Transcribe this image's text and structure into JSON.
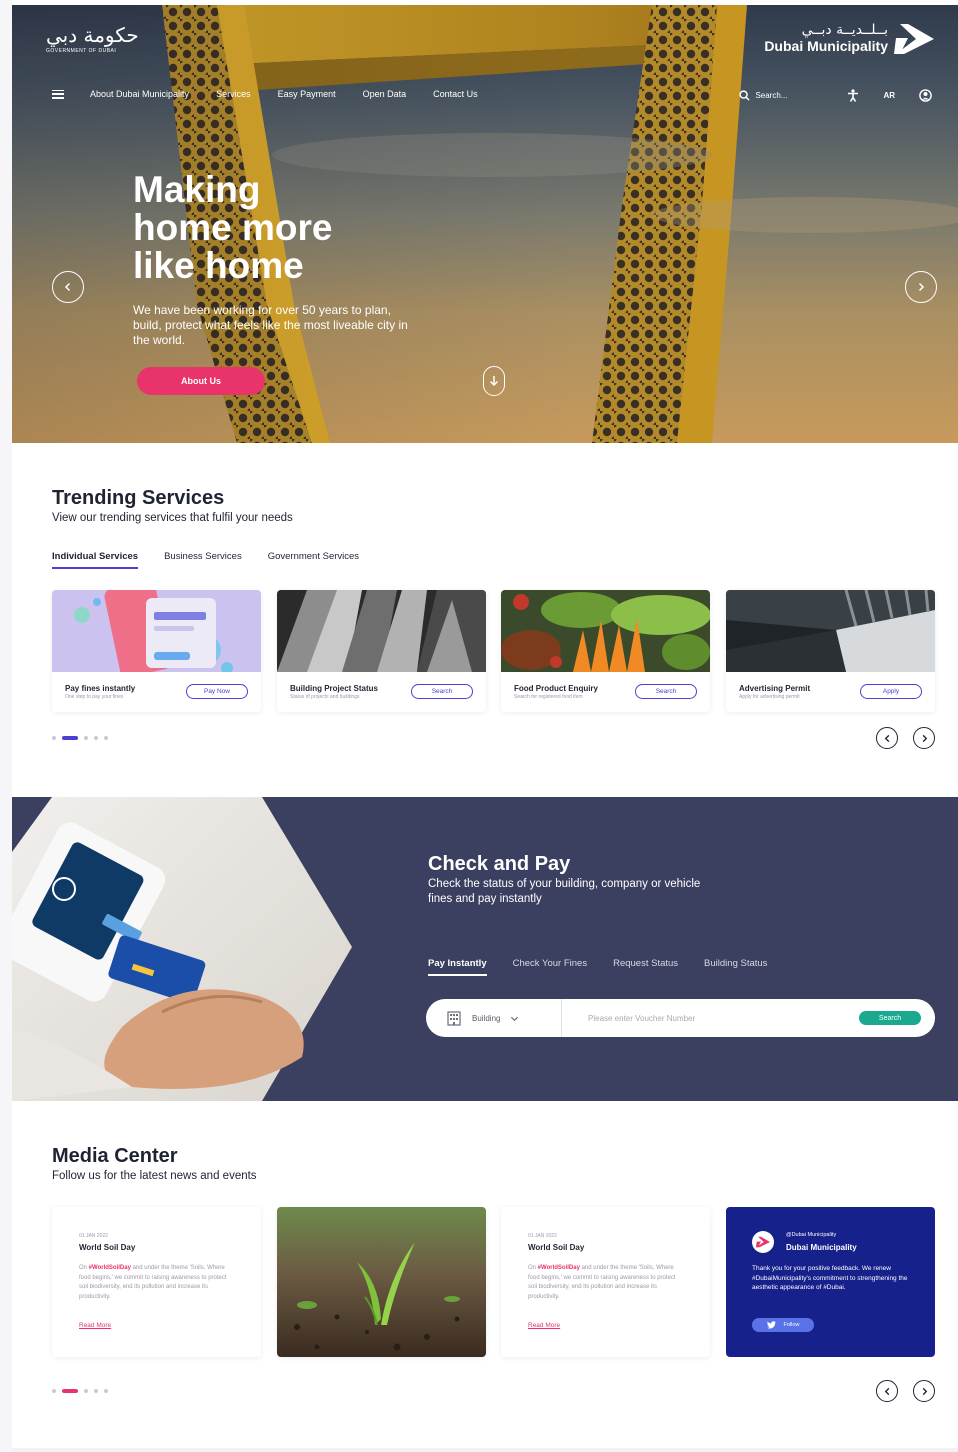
{
  "header": {
    "gov_logo_arabic": "حكومة دبي",
    "gov_logo_sub": "GOVERNMENT OF DUBAI",
    "dm_logo_arabic": "بــلــديــة دبــي",
    "dm_logo_name": "Dubai Municipality",
    "nav": [
      "About Dubai Municipality",
      "Services",
      "Easy Payment",
      "Open Data",
      "Contact Us"
    ],
    "search_placeholder": "Search...",
    "lang": "AR"
  },
  "hero": {
    "title_lines": [
      "Making",
      "home more",
      "like home"
    ],
    "description": "We have been working for over 50 years to plan, build, protect what feels like the most liveable city in the world.",
    "cta": "About Us"
  },
  "trending": {
    "title": "Trending Services",
    "subtitle": "View our trending services that fulfil your needs",
    "tabs": [
      "Individual Services",
      "Business Services",
      "Government Services"
    ],
    "active_tab": 0,
    "cards": [
      {
        "name": "Pay fines instantly",
        "desc": "One step to pay your fines",
        "button": "Pay Now"
      },
      {
        "name": "Building Project Status",
        "desc": "Status of projects and buildings",
        "button": "Search"
      },
      {
        "name": "Food Product Enquiry",
        "desc": "Search for registered food item",
        "button": "Search"
      },
      {
        "name": "Advertising Permit",
        "desc": "Apply for advertising permit",
        "button": "Apply"
      }
    ],
    "pagination": {
      "count": 5,
      "active": 1,
      "active_color": "#4d3fd1"
    }
  },
  "check_pay": {
    "title": "Check and Pay",
    "subtitle": "Check the status of your building, company or vehicle fines and pay instantly",
    "tabs": [
      "Pay Instantly",
      "Check Your Fines",
      "Request Status",
      "Building Status"
    ],
    "active_tab": 0,
    "select_value": "Building",
    "input_placeholder": "Please enter Voucher Number",
    "button": "Search"
  },
  "media": {
    "title": "Media Center",
    "subtitle": "Follow us for the latest news and events",
    "news": [
      {
        "date": "01 JAN 2022",
        "title": "World Soil Day",
        "tag": "#WorldSoilDay",
        "body_before": "On ",
        "body_after": " and under the theme 'Soils, Where food begins,' we commit to raising awareness to protect soil biodiversity, end its pollution and increase its productivity.",
        "link": "Read More"
      },
      {
        "date": "01 JAN 2022",
        "title": "World Soil Day",
        "tag": "#WorldSoilDay",
        "body_before": "On ",
        "body_after": " and under the theme 'Soils, Where food begins,' we commit to raising awareness to protect soil biodiversity, end its pollution and increase its productivity.",
        "link": "Read More"
      }
    ],
    "tweet": {
      "handle": "@Dubai Municipality",
      "name": "Dubai Municipality",
      "body": "Thank you for your positive feedback. We renew #DubaiMunicipality's commitment to strengthening the aesthetic appearance of #Dubai.",
      "button": "Follow"
    },
    "pagination": {
      "count": 5,
      "active": 1,
      "active_color": "#e8336b"
    }
  }
}
